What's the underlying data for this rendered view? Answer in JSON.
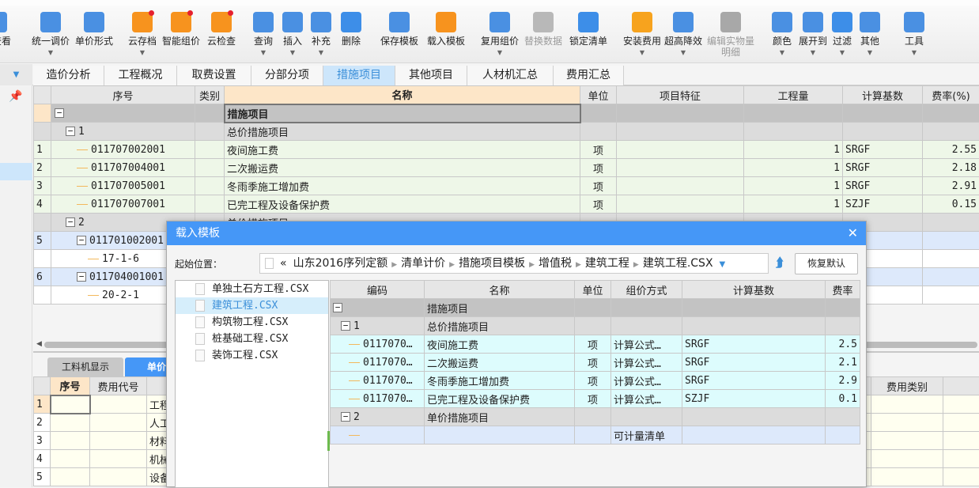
{
  "toolbar": {
    "buttons": [
      {
        "label": "用查看",
        "icon": "view-icon",
        "dropdown": false,
        "disabled": false
      },
      {
        "label": "统一调价",
        "icon": "unified-price-icon",
        "dropdown": true,
        "disabled": false
      },
      {
        "label": "单价形式",
        "icon": "unit-price-form-icon",
        "dropdown": false,
        "disabled": false
      },
      {
        "label": "云存档",
        "icon": "cloud-upload-icon",
        "dropdown": true,
        "disabled": false
      },
      {
        "label": "智能组价",
        "icon": "smart-pricing-icon",
        "dropdown": false,
        "disabled": false
      },
      {
        "label": "云检查",
        "icon": "cloud-check-icon",
        "dropdown": false,
        "disabled": false
      },
      {
        "label": "查询",
        "icon": "query-icon",
        "dropdown": true,
        "disabled": false
      },
      {
        "label": "插入",
        "icon": "insert-icon",
        "dropdown": true,
        "disabled": false
      },
      {
        "label": "补充",
        "icon": "supplement-icon",
        "dropdown": true,
        "disabled": false
      },
      {
        "label": "删除",
        "icon": "delete-icon",
        "dropdown": false,
        "disabled": false
      },
      {
        "label": "保存模板",
        "icon": "save-template-icon",
        "dropdown": false,
        "disabled": false
      },
      {
        "label": "载入模板",
        "icon": "load-template-icon",
        "dropdown": false,
        "disabled": false
      },
      {
        "label": "复用组价",
        "icon": "reuse-pricing-icon",
        "dropdown": true,
        "disabled": false
      },
      {
        "label": "替换数据",
        "icon": "replace-data-icon",
        "dropdown": false,
        "disabled": true
      },
      {
        "label": "锁定清单",
        "icon": "lock-icon",
        "dropdown": false,
        "disabled": false
      },
      {
        "label": "安装费用",
        "icon": "install-cost-icon",
        "dropdown": true,
        "disabled": false
      },
      {
        "label": "超高降效",
        "icon": "high-rise-icon",
        "dropdown": true,
        "disabled": false
      },
      {
        "label": "编辑实物量明细",
        "label2": "明细",
        "icon": "edit-quantity-icon",
        "dropdown": false,
        "disabled": true
      },
      {
        "label": "颜色",
        "icon": "color-bucket-icon",
        "dropdown": true,
        "disabled": false
      },
      {
        "label": "展开到",
        "icon": "expand-to-icon",
        "dropdown": true,
        "disabled": false
      },
      {
        "label": "过滤",
        "icon": "filter-icon",
        "dropdown": true,
        "disabled": false
      },
      {
        "label": "其他",
        "icon": "grid-other-icon",
        "dropdown": true,
        "disabled": false
      },
      {
        "label": "工具",
        "icon": "tools-icon",
        "dropdown": true,
        "disabled": false
      }
    ],
    "edit_label_line1": "编辑实物量",
    "edit_label_line2": "明细"
  },
  "tabs": [
    {
      "label": "造价分析",
      "active": false
    },
    {
      "label": "工程概况",
      "active": false
    },
    {
      "label": "取费设置",
      "active": false
    },
    {
      "label": "分部分项",
      "active": false
    },
    {
      "label": "措施项目",
      "active": true
    },
    {
      "label": "其他项目",
      "active": false
    },
    {
      "label": "人材机汇总",
      "active": false
    },
    {
      "label": "费用汇总",
      "active": false
    }
  ],
  "main_grid": {
    "headers": [
      "",
      "序号",
      "类别",
      "名称",
      "单位",
      "项目特征",
      "工程量",
      "计算基数",
      "费率(%)"
    ],
    "rows": [
      {
        "idx": "",
        "code": "",
        "type": "",
        "name": "措施项目",
        "unit": "",
        "feature": "",
        "qty": "",
        "base": "",
        "rate": "",
        "style": "top",
        "level": 0,
        "toggle": true
      },
      {
        "idx": "",
        "code": "1",
        "type": "",
        "name": "总价措施项目",
        "unit": "",
        "feature": "",
        "qty": "",
        "base": "",
        "rate": "",
        "style": "grp",
        "level": 1,
        "toggle": true
      },
      {
        "idx": "1",
        "code": "011707002001",
        "type": "",
        "name": "夜间施工费",
        "unit": "项",
        "feature": "",
        "qty": "1",
        "base": "SRGF",
        "rate": "2.55",
        "style": "grn",
        "level": 2
      },
      {
        "idx": "2",
        "code": "011707004001",
        "type": "",
        "name": "二次搬运费",
        "unit": "项",
        "feature": "",
        "qty": "1",
        "base": "SRGF",
        "rate": "2.18",
        "style": "grn",
        "level": 2
      },
      {
        "idx": "3",
        "code": "011707005001",
        "type": "",
        "name": "冬雨季施工增加费",
        "unit": "项",
        "feature": "",
        "qty": "1",
        "base": "SRGF",
        "rate": "2.91",
        "style": "grn",
        "level": 2
      },
      {
        "idx": "4",
        "code": "011707007001",
        "type": "",
        "name": "已完工程及设备保护费",
        "unit": "项",
        "feature": "",
        "qty": "1",
        "base": "SZJF",
        "rate": "0.15",
        "style": "grn",
        "level": 2
      },
      {
        "idx": "",
        "code": "2",
        "type": "",
        "name": "单价措施项目",
        "unit": "",
        "feature": "",
        "qty": "",
        "base": "",
        "rate": "",
        "style": "grp",
        "level": 1,
        "toggle": true
      },
      {
        "idx": "5",
        "code": "011701002001",
        "type": "",
        "name": "",
        "unit": "",
        "feature": "",
        "qty": "",
        "base": "",
        "rate": "",
        "style": "blu",
        "level": 2,
        "toggle": true
      },
      {
        "idx": "",
        "code": "17-1-6",
        "type": "",
        "name": "",
        "unit": "",
        "feature": "",
        "qty": "",
        "base": "",
        "rate": "",
        "style": "wht",
        "level": 3
      },
      {
        "idx": "6",
        "code": "011704001001",
        "type": "",
        "name": "",
        "unit": "",
        "feature": "",
        "qty": "",
        "base": "",
        "rate": "",
        "style": "blu",
        "level": 2,
        "toggle": true
      },
      {
        "idx": "",
        "code": "20-2-1",
        "type": "",
        "name": "",
        "unit": "",
        "feature": "",
        "qty": "",
        "base": "",
        "rate": "",
        "style": "wht",
        "level": 3
      }
    ]
  },
  "bottom_panel": {
    "tabs": [
      {
        "label": "工料机显示",
        "active": false
      },
      {
        "label": "单价构成",
        "active": true
      }
    ],
    "headers": [
      "",
      "序号",
      "费用代号",
      "",
      "费用类别",
      ""
    ],
    "rows": [
      {
        "idx": "1",
        "name": "工程"
      },
      {
        "idx": "2",
        "name": "人工"
      },
      {
        "idx": "3",
        "name": "材料"
      },
      {
        "idx": "4",
        "name": "机械"
      },
      {
        "idx": "5",
        "name": "设备"
      }
    ]
  },
  "dialog": {
    "title": "载入模板",
    "close_icon": "close-icon",
    "start_label": "起始位置：",
    "path": [
      "山东2016序列定额",
      "清单计价",
      "措施项目模板",
      "增值税",
      "建筑工程",
      "建筑工程.CSX"
    ],
    "path_prefix": "«",
    "restore_label": "恢复默认",
    "files": [
      {
        "name": "单独土石方工程.CSX",
        "selected": false
      },
      {
        "name": "建筑工程.CSX",
        "selected": true
      },
      {
        "name": "构筑物工程.CSX",
        "selected": false
      },
      {
        "name": "桩基础工程.CSX",
        "selected": false
      },
      {
        "name": "装饰工程.CSX",
        "selected": false
      }
    ],
    "grid": {
      "headers": [
        "编码",
        "名称",
        "单位",
        "组价方式",
        "计算基数",
        "费率"
      ],
      "rows": [
        {
          "code": "",
          "name": "措施项目",
          "unit": "",
          "method": "",
          "base": "",
          "rate": "",
          "style": "top",
          "toggle": true,
          "level": 0
        },
        {
          "code": "1",
          "name": "总价措施项目",
          "unit": "",
          "method": "",
          "base": "",
          "rate": "",
          "style": "grp",
          "toggle": true,
          "level": 1
        },
        {
          "code": "0117070…",
          "name": "夜间施工费",
          "unit": "项",
          "method": "计算公式…",
          "base": "SRGF",
          "rate": "2.5",
          "style": "cyan",
          "level": 2
        },
        {
          "code": "0117070…",
          "name": "二次搬运费",
          "unit": "项",
          "method": "计算公式…",
          "base": "SRGF",
          "rate": "2.1",
          "style": "cyan",
          "level": 2
        },
        {
          "code": "0117070…",
          "name": "冬雨季施工增加费",
          "unit": "项",
          "method": "计算公式…",
          "base": "SRGF",
          "rate": "2.9",
          "style": "cyan",
          "level": 2
        },
        {
          "code": "0117070…",
          "name": "已完工程及设备保护费",
          "unit": "项",
          "method": "计算公式…",
          "base": "SZJF",
          "rate": "0.1",
          "style": "cyan",
          "level": 2
        },
        {
          "code": "2",
          "name": "单价措施项目",
          "unit": "",
          "method": "",
          "base": "",
          "rate": "",
          "style": "grp",
          "toggle": true,
          "level": 1
        },
        {
          "code": "",
          "name": "",
          "unit": "",
          "method": "可计量清单",
          "base": "",
          "rate": "",
          "style": "blu",
          "level": 2
        }
      ]
    }
  }
}
